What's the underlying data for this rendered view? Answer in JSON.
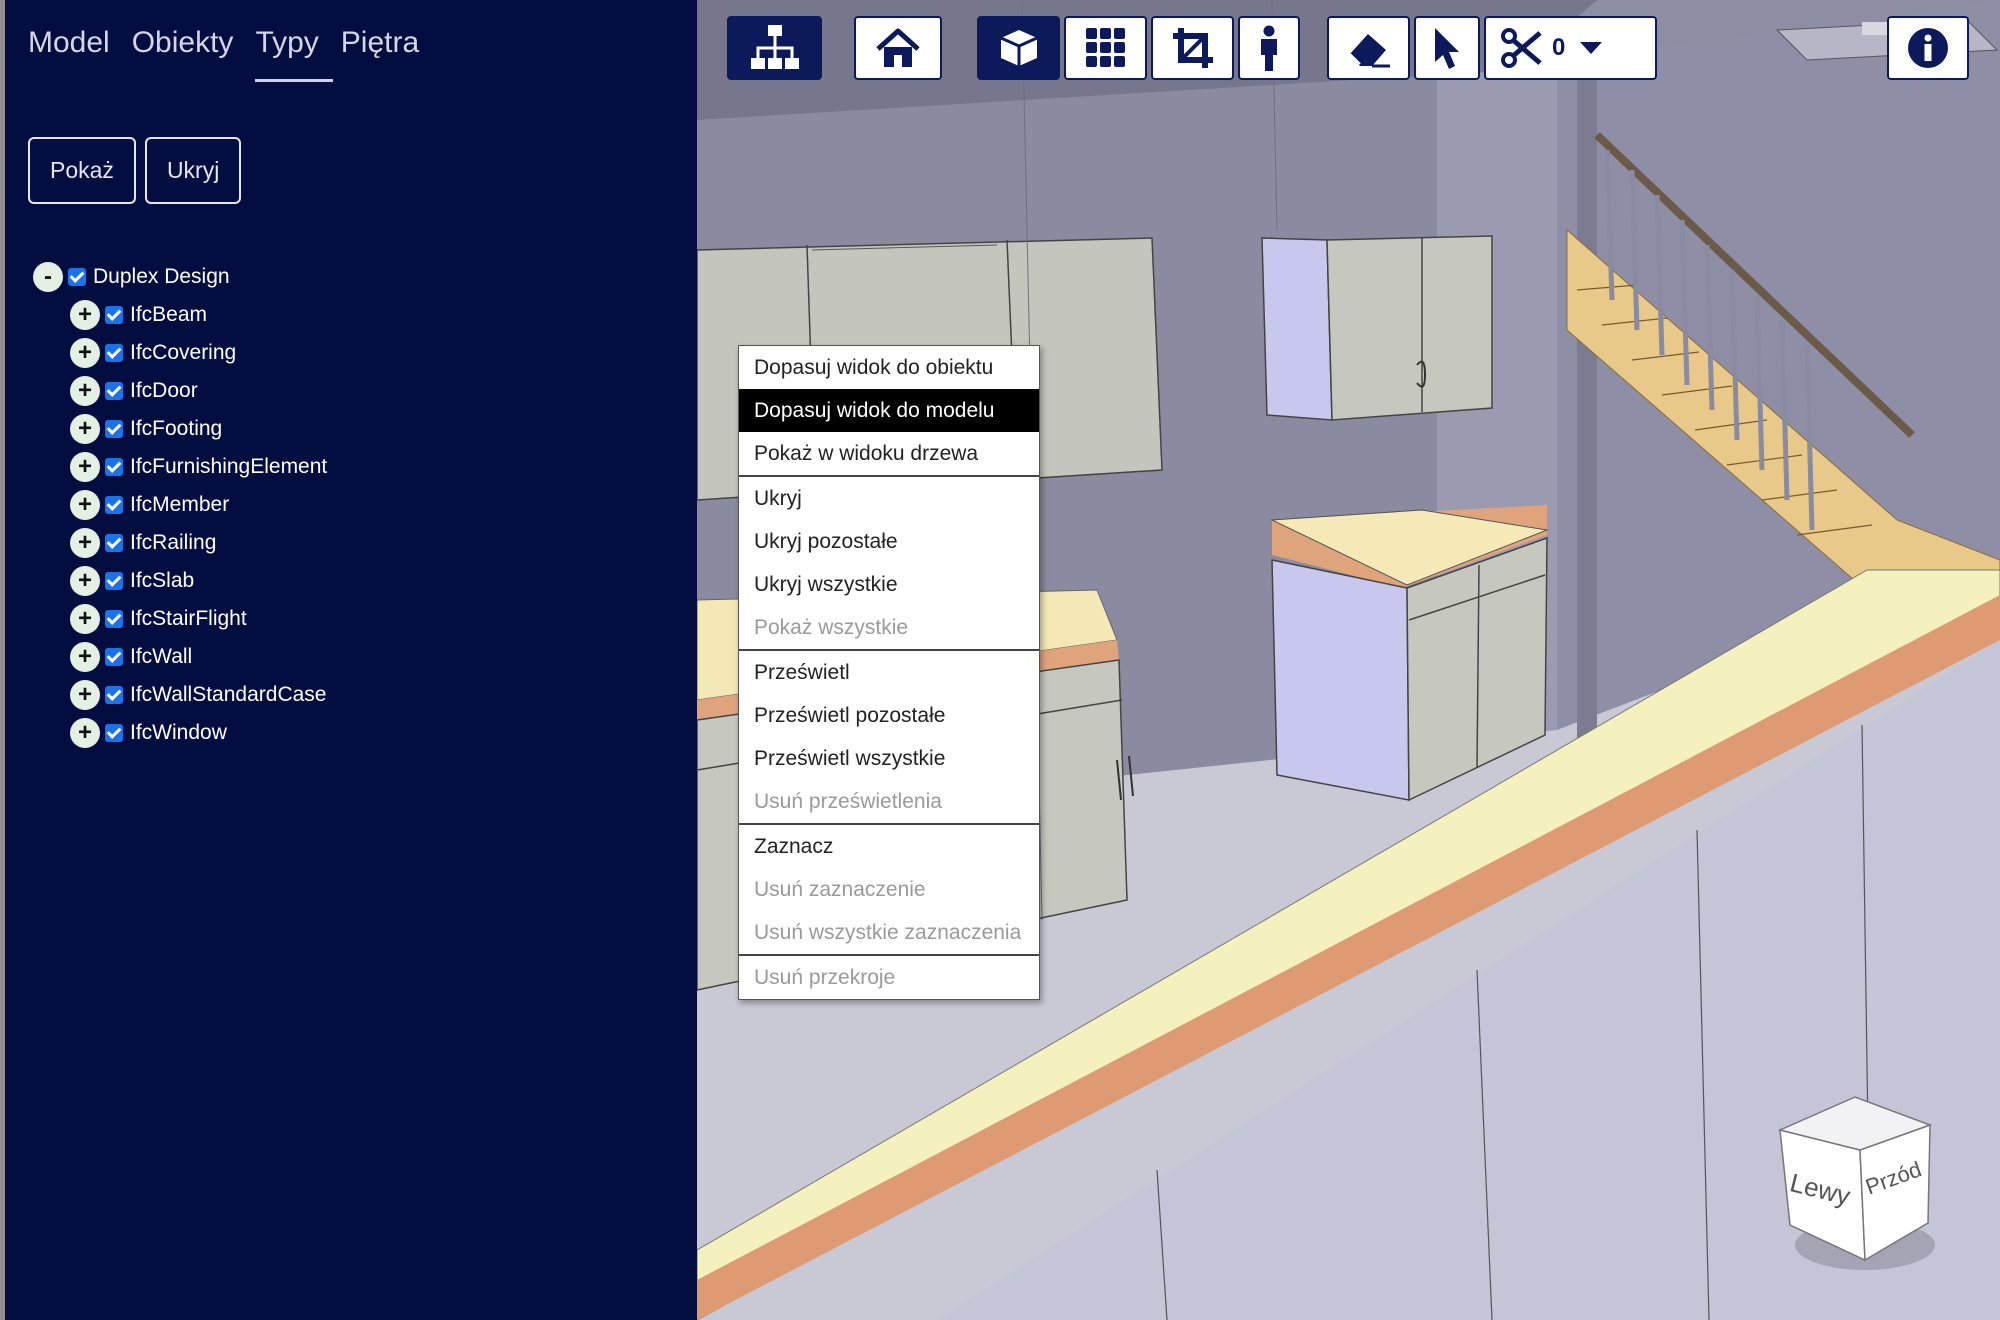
{
  "sidebar": {
    "tabs": [
      {
        "label": "Model"
      },
      {
        "label": "Obiekty"
      },
      {
        "label": "Typy"
      },
      {
        "label": "Piętra"
      }
    ],
    "active_tab": "Typy",
    "buttons": {
      "show": "Pokaż",
      "hide": "Ukryj"
    },
    "tree": {
      "root": {
        "toggle": "-",
        "label": "Duplex Design"
      },
      "children": [
        {
          "toggle": "+",
          "label": "IfcBeam"
        },
        {
          "toggle": "+",
          "label": "IfcCovering"
        },
        {
          "toggle": "+",
          "label": "IfcDoor"
        },
        {
          "toggle": "+",
          "label": "IfcFooting"
        },
        {
          "toggle": "+",
          "label": "IfcFurnishingElement"
        },
        {
          "toggle": "+",
          "label": "IfcMember"
        },
        {
          "toggle": "+",
          "label": "IfcRailing"
        },
        {
          "toggle": "+",
          "label": "IfcSlab"
        },
        {
          "toggle": "+",
          "label": "IfcStairFlight"
        },
        {
          "toggle": "+",
          "label": "IfcWall"
        },
        {
          "toggle": "+",
          "label": "IfcWallStandardCase"
        },
        {
          "toggle": "+",
          "label": "IfcWindow"
        }
      ]
    }
  },
  "toolbar": {
    "buttons": [
      {
        "icon": "sitemap-icon"
      },
      {
        "icon": "home-icon"
      },
      {
        "icon": "cube-icon"
      },
      {
        "icon": "grid-icon"
      },
      {
        "icon": "crop-icon"
      },
      {
        "icon": "person-icon"
      },
      {
        "icon": "eraser-icon"
      },
      {
        "icon": "pointer-icon"
      },
      {
        "icon": "scissors-icon"
      },
      {
        "icon": "info-icon"
      }
    ],
    "section_count": "0"
  },
  "context_menu": {
    "items": [
      {
        "label": "Dopasuj widok do obiektu"
      },
      {
        "label": "Dopasuj widok do modelu"
      },
      {
        "label": "Pokaż w widoku drzewa"
      },
      {
        "label": "Ukryj"
      },
      {
        "label": "Ukryj pozostałe"
      },
      {
        "label": "Ukryj wszystkie"
      },
      {
        "label": "Pokaż wszystkie"
      },
      {
        "label": "Prześwietl"
      },
      {
        "label": "Prześwietl pozostałe"
      },
      {
        "label": "Prześwietl wszystkie"
      },
      {
        "label": "Usuń prześwietlenia"
      },
      {
        "label": "Zaznacz"
      },
      {
        "label": "Usuń zaznaczenie"
      },
      {
        "label": "Usuń wszystkie zaznaczenia"
      },
      {
        "label": "Usuń przekroje"
      }
    ]
  },
  "navcube": {
    "left": "Lewy",
    "front": "Przód"
  },
  "colors": {
    "sidebar_bg": "#030d3f",
    "toolbar_accent": "#0c1a5c",
    "checkbox": "#1a73e8",
    "menu_highlight": "#000000"
  }
}
